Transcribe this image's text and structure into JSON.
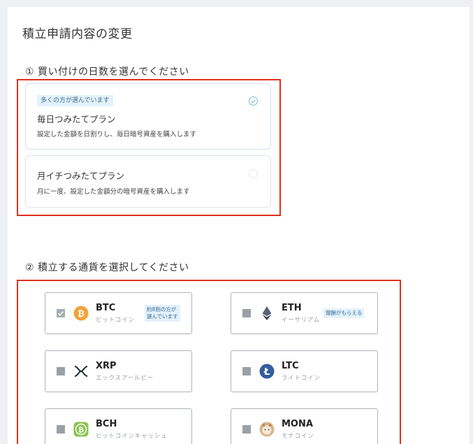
{
  "page": {
    "title": "積立申請内容の変更"
  },
  "step1": {
    "label": "① 買い付けの日数を選んでください",
    "plans": [
      {
        "badge": "多くの方が選んでいます",
        "title": "毎日つみたてプラン",
        "description": "設定した金額を日割りし、毎日暗号資産を購入します",
        "selected": true
      },
      {
        "title": "月イチつみたてプラン",
        "description": "月に一度、設定した金額分の暗号資産を購入します",
        "selected": false
      }
    ]
  },
  "step2": {
    "label": "② 積立する通貨を選択してください",
    "coins": [
      {
        "symbol": "BTC",
        "name": "ビットコイン",
        "note_line1": "約8割の方が",
        "note_line2": "選んでいます",
        "checked": true,
        "icon": "bitcoin-icon",
        "color": "#f1a33a"
      },
      {
        "symbol": "ETH",
        "name": "イーサリアム",
        "note_line1": "報酬がもらえる",
        "checked": false,
        "icon": "ethereum-icon",
        "color": "#5a6275"
      },
      {
        "symbol": "XRP",
        "name": "エックスアールピー",
        "checked": false,
        "icon": "xrp-icon",
        "color": "#23292f"
      },
      {
        "symbol": "LTC",
        "name": "ライトコイン",
        "checked": false,
        "icon": "litecoin-icon",
        "color": "#345d9d"
      },
      {
        "symbol": "BCH",
        "name": "ビットコインキャッシュ",
        "checked": false,
        "icon": "bitcoin-cash-icon",
        "color": "#8dc351"
      },
      {
        "symbol": "MONA",
        "name": "モナコイン",
        "checked": false,
        "icon": "monacoin-icon",
        "color": "#c89a6a"
      }
    ]
  },
  "colors": {
    "highlight_border": "#e0301e",
    "badge_bg": "#e3f1fb"
  }
}
